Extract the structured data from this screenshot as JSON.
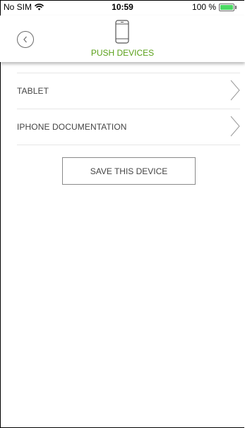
{
  "status_bar": {
    "carrier": "No SIM",
    "time": "10:59",
    "battery_text": "100 %",
    "battery_level": 1.0,
    "battery_color": "#4cd964"
  },
  "header": {
    "back_icon": "back-chevron-icon",
    "device_icon": "smartphone-icon",
    "title": "PUSH DEVICES",
    "title_color": "#5aa019"
  },
  "devices": [
    {
      "label": "TABLET"
    },
    {
      "label": "IPHONE DOCUMENTATION"
    }
  ],
  "save_button_label": "SAVE THIS DEVICE"
}
